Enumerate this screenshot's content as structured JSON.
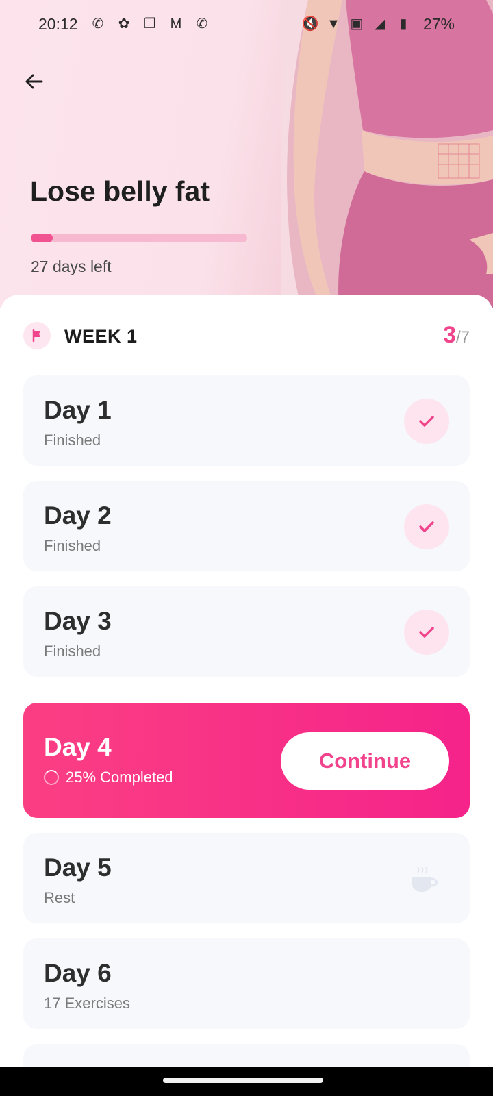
{
  "status_bar": {
    "time": "20:12",
    "left_icons": [
      "whatsapp-icon",
      "notification-icon",
      "copy-icon",
      "gmail-icon",
      "whatsapp-icon"
    ],
    "right_icons": [
      "mute-icon",
      "wifi-icon",
      "volte-icon",
      "signal-icon",
      "battery-icon"
    ],
    "battery": "27%"
  },
  "header": {
    "back_icon": "back-arrow-icon",
    "title": "Lose belly fat",
    "progress_fraction": 0.1,
    "days_left": "27 days left"
  },
  "week": {
    "label": "WEEK 1",
    "completed": "3",
    "total": "/7",
    "icon": "flag-icon"
  },
  "days": [
    {
      "title": "Day 1",
      "subtitle": "Finished",
      "state": "finished"
    },
    {
      "title": "Day 2",
      "subtitle": "Finished",
      "state": "finished"
    },
    {
      "title": "Day 3",
      "subtitle": "Finished",
      "state": "finished"
    },
    {
      "title": "Day 4",
      "subtitle": "25% Completed",
      "state": "active",
      "action": "Continue"
    },
    {
      "title": "Day 5",
      "subtitle": "Rest",
      "state": "rest"
    },
    {
      "title": "Day 6",
      "subtitle": "17 Exercises",
      "state": "upcoming"
    }
  ],
  "colors": {
    "accent": "#f0458c",
    "card_bg": "#f7f8fc",
    "active_gradient_start": "#fb3f83",
    "active_gradient_end": "#f5238a"
  }
}
